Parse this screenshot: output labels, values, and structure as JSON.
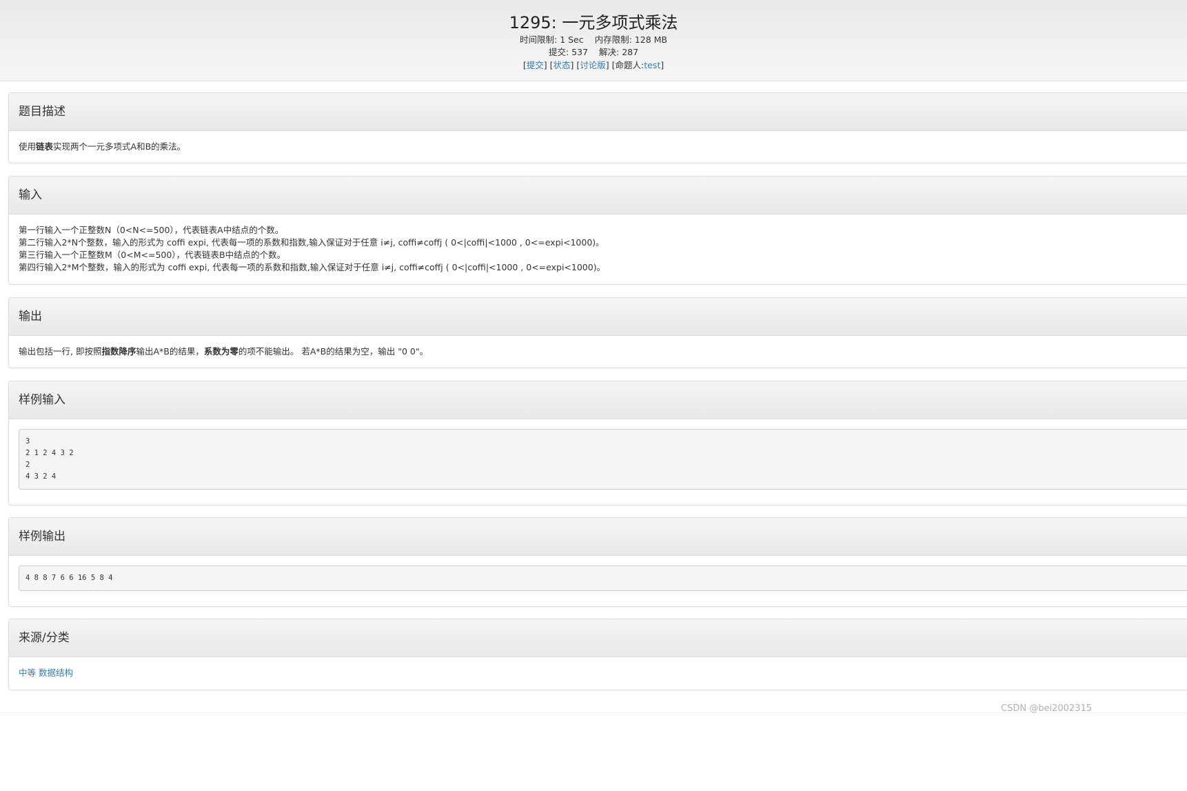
{
  "header": {
    "title": "1295: 一元多项式乘法",
    "time_limit_label": "时间限制:",
    "time_limit_value": "1 Sec",
    "memory_limit_label": "内存限制:",
    "memory_limit_value": "128 MB",
    "submit_count_label": "提交:",
    "submit_count_value": "537",
    "solved_count_label": "解决:",
    "solved_count_value": "287",
    "link_submit": "提交",
    "link_status": "状态",
    "link_discuss": "讨论版",
    "author_label": "命题人:",
    "author_value": "test"
  },
  "description": {
    "heading": "题目描述",
    "text_before": "使用",
    "text_bold": "链表",
    "text_after": "实现两个一元多项式A和B的乘法。"
  },
  "input": {
    "heading": "输入",
    "lines": [
      "第一行输入一个正整数N（0<N<=500），代表链表A中结点的个数。",
      "第二行输入2*N个整数，输入的形式为 coffi expi, 代表每一项的系数和指数,输入保证对于任意 i≠j, coffi≠coffj ( 0<|coffi|<1000 , 0<=expi<1000)。",
      "第三行输入一个正整数M（0<M<=500），代表链表B中结点的个数。",
      "第四行输入2*M个整数，输入的形式为 coffi expi, 代表每一项的系数和指数,输入保证对于任意 i≠j, coffi≠coffj ( 0<|coffi|<1000 , 0<=expi<1000)。"
    ]
  },
  "output": {
    "heading": "输出",
    "part1": "输出包括一行, 即按照",
    "bold1": "指数降序",
    "part2": "输出A*B的结果，",
    "bold2": "系数为零",
    "part3": "的项不能输出。 若A*B的结果为空，输出 \"0 0\"。"
  },
  "sample_input": {
    "heading": "样例输入",
    "content": "3\n2 1 2 4 3 2\n2\n4 3 2 4"
  },
  "sample_output": {
    "heading": "样例输出",
    "content": "4 8 8 7 6 6 16 5 8 4"
  },
  "source": {
    "heading": "来源/分类",
    "tag_1": "中等",
    "tag_2": "数据结构"
  },
  "watermark": "CSDN @bei2002315"
}
